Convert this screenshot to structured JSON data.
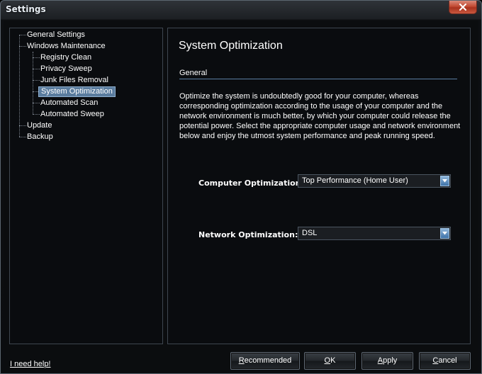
{
  "window": {
    "title": "Settings"
  },
  "tree": {
    "items": [
      {
        "label": "General Settings"
      },
      {
        "label": "Windows Maintenance"
      },
      {
        "label": "Registry Clean"
      },
      {
        "label": "Privacy Sweep"
      },
      {
        "label": "Junk Files Removal"
      },
      {
        "label": "System Optimization",
        "selected": true
      },
      {
        "label": "Automated Scan"
      },
      {
        "label": "Automated Sweep"
      },
      {
        "label": "Update"
      },
      {
        "label": "Backup"
      }
    ]
  },
  "content": {
    "title": "System Optimization",
    "section": "General",
    "description": "Optimize the system is undoubtedly good for your computer, whereas corresponding optimization according to the usage of your computer and the network environment is much better, by which your computer could release the potential power. Select the appropriate computer usage and network environment below and enjoy the utmost system performance and peak running speed.",
    "computer_label": "Computer Optimization:",
    "computer_value": "Top Performance (Home User)",
    "network_label": "Network Optimization:",
    "network_value": "DSL"
  },
  "footer": {
    "help_link": "I need help!",
    "buttons": {
      "recommended": {
        "first": "R",
        "rest": "ecommended"
      },
      "ok": {
        "first": "O",
        "rest": "K"
      },
      "apply": {
        "first": "A",
        "rest": "pply"
      },
      "cancel": {
        "first": "C",
        "rest": "ancel"
      }
    }
  },
  "colors": {
    "accent": "#5a7ea2",
    "selected_bg": "#5a7c9e",
    "close": "#c24a33"
  },
  "icons": {
    "close": "close-icon",
    "dropdown": "chevron-down-icon"
  }
}
